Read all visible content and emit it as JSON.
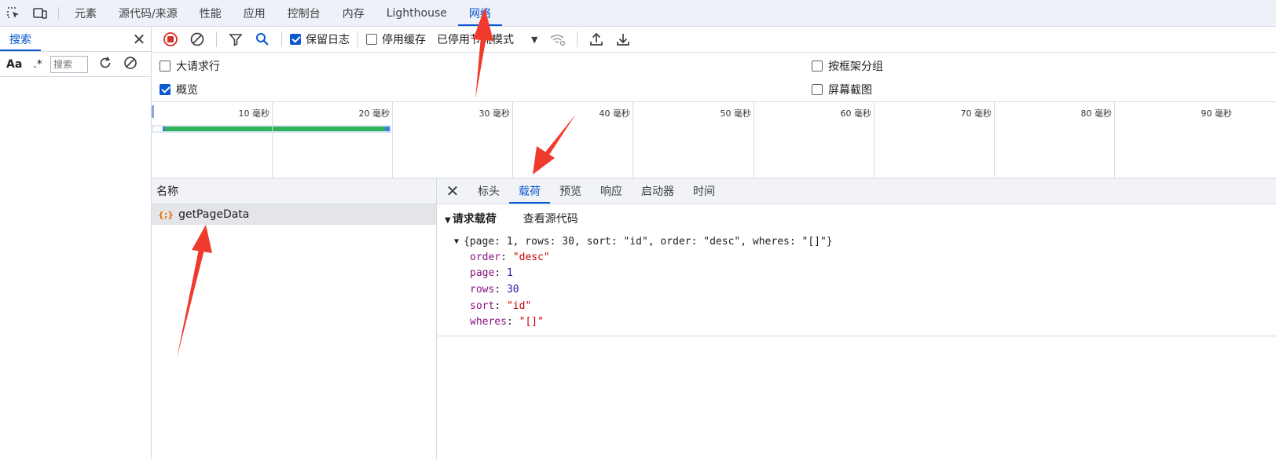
{
  "top_tabs": [
    "元素",
    "源代码/来源",
    "性能",
    "应用",
    "控制台",
    "内存",
    "Lighthouse",
    "网络"
  ],
  "top_tabs_active_index": 7,
  "search_panel": {
    "tab_label": "搜索",
    "case_toggle": "Aa",
    "regex_toggle": ".*",
    "input_placeholder": "搜索"
  },
  "network_toolbar": {
    "preserve_log": {
      "label": "保留日志",
      "checked": true
    },
    "disable_cache": {
      "label": "停用缓存",
      "checked": false
    },
    "throttling": "已停用节流模式"
  },
  "options": {
    "large_rows": {
      "label": "大请求行",
      "checked": false
    },
    "overview": {
      "label": "概览",
      "checked": true
    },
    "group_by_frame": {
      "label": "按框架分组",
      "checked": false
    },
    "screenshots": {
      "label": "屏幕截图",
      "checked": false
    }
  },
  "timeline_ticks": [
    "10 毫秒",
    "20 毫秒",
    "30 毫秒",
    "40 毫秒",
    "50 毫秒",
    "60 毫秒",
    "70 毫秒",
    "80 毫秒",
    "90 毫秒"
  ],
  "request_list": {
    "header": "名称",
    "rows": [
      {
        "name": "getPageData",
        "icon": "{;}"
      }
    ]
  },
  "details": {
    "tabs": [
      "标头",
      "载荷",
      "预览",
      "响应",
      "启动器",
      "时间"
    ],
    "active_tab_index": 1,
    "section_title": "请求载荷",
    "view_source": "查看源代码",
    "summary": "{page: 1, rows: 30, sort: \"id\", order: \"desc\", wheres: \"[]\"}",
    "fields": [
      {
        "key": "order",
        "value": "\"desc\"",
        "type": "string"
      },
      {
        "key": "page",
        "value": "1",
        "type": "number"
      },
      {
        "key": "rows",
        "value": "30",
        "type": "number"
      },
      {
        "key": "sort",
        "value": "\"id\"",
        "type": "string"
      },
      {
        "key": "wheres",
        "value": "\"[]\"",
        "type": "string"
      }
    ]
  },
  "colors": {
    "accent": "#0b57d0",
    "annotation": "#f03a2e",
    "record": "#d93025"
  }
}
